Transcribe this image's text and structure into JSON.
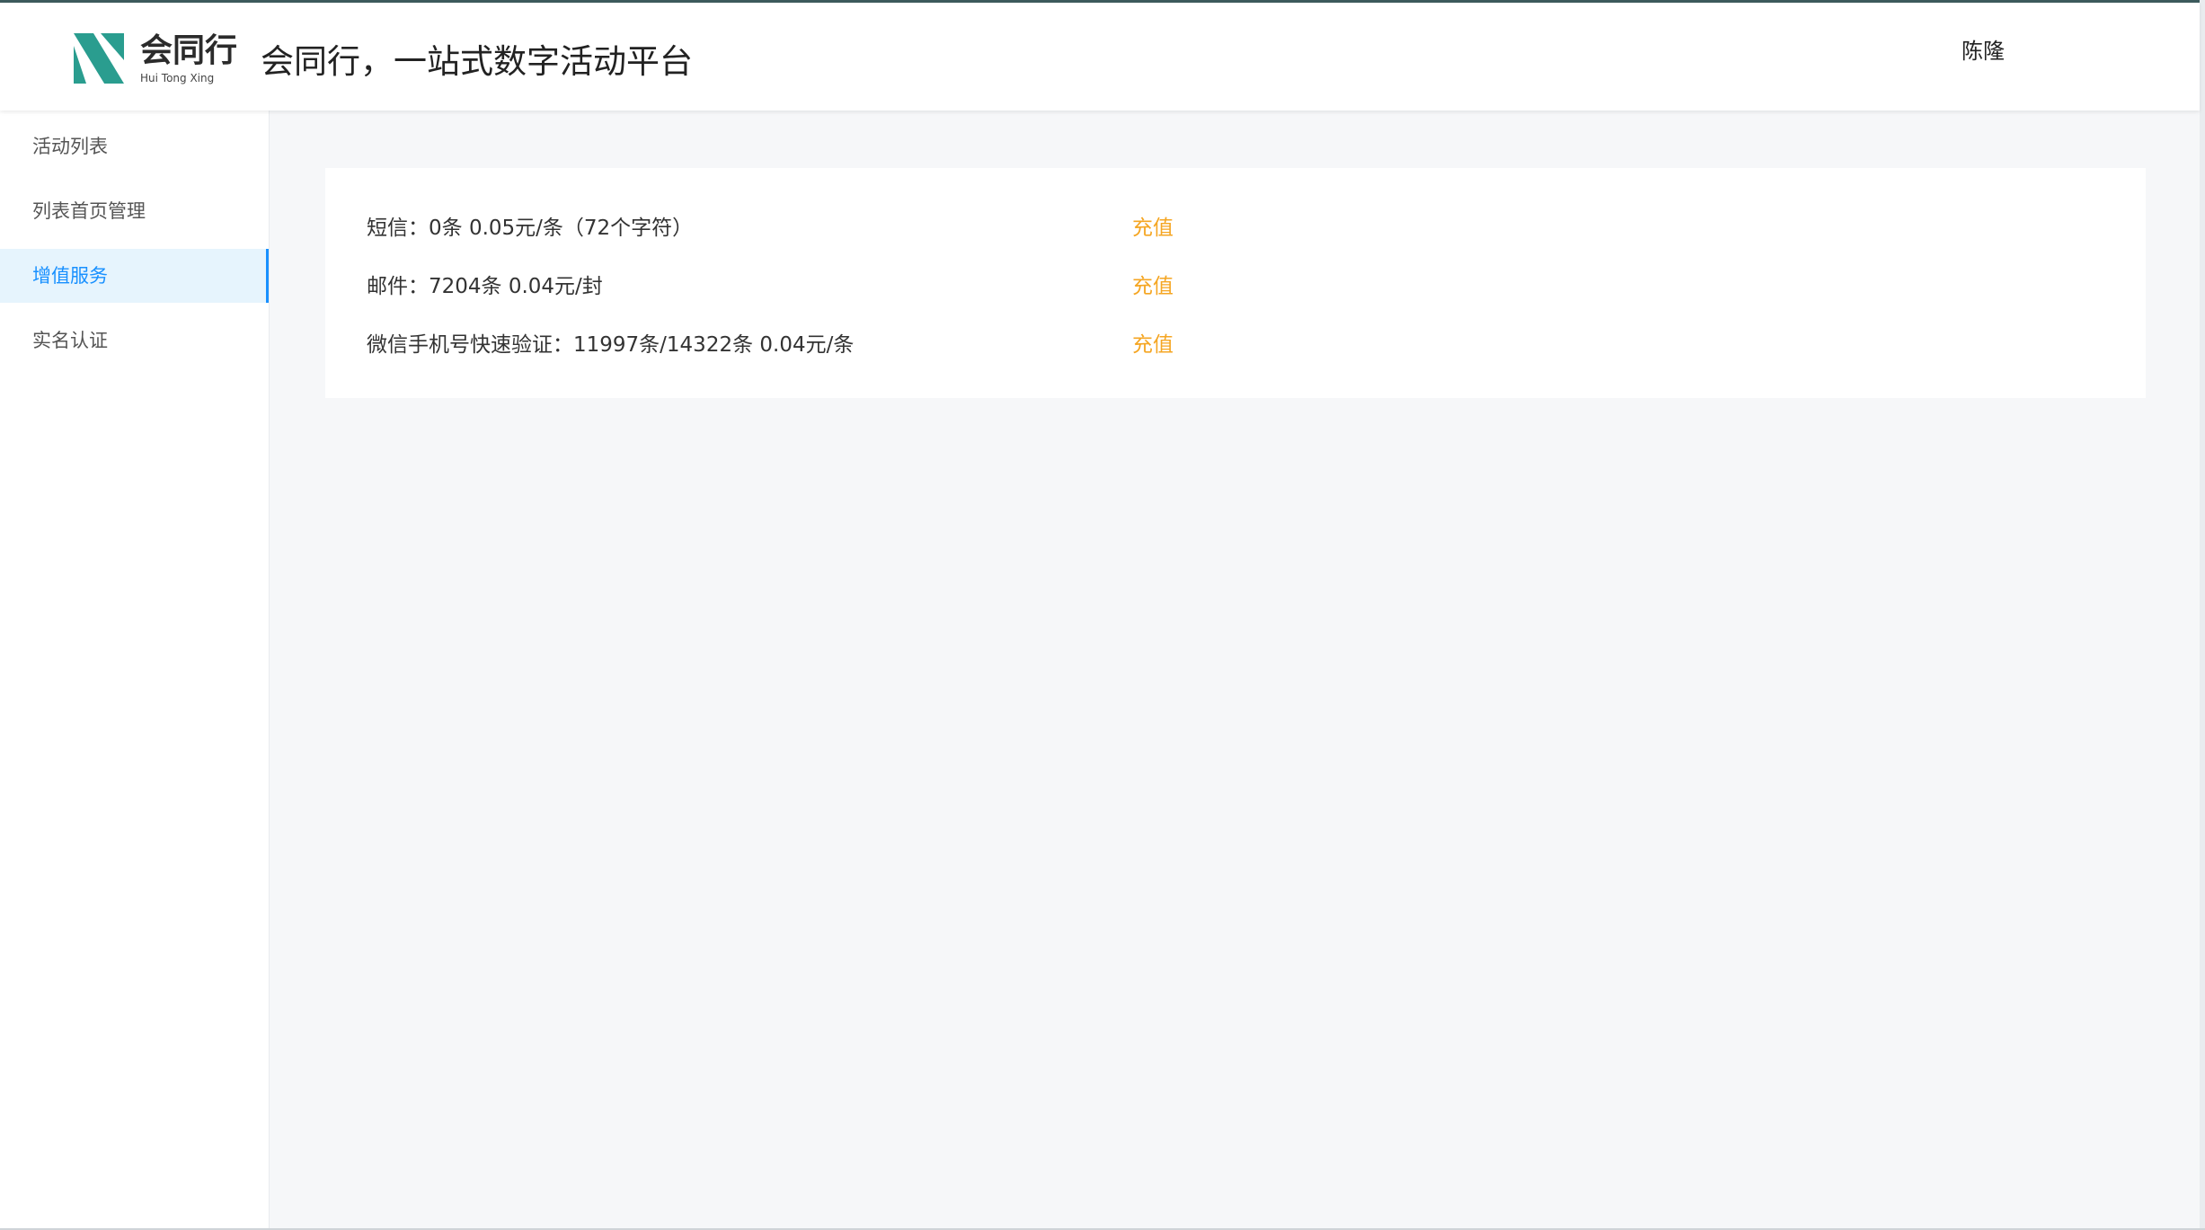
{
  "header": {
    "logo_name": "会同行",
    "logo_pinyin": "Hui Tong Xing",
    "site_title": "会同行，一站式数字活动平台",
    "user_name": "陈隆"
  },
  "sidebar": {
    "items": [
      {
        "label": "活动列表",
        "active": false
      },
      {
        "label": "列表首页管理",
        "active": false
      },
      {
        "label": "增值服务",
        "active": true
      },
      {
        "label": "实名认证",
        "active": false
      }
    ]
  },
  "services": [
    {
      "text": "短信：0条 0.05元/条（72个字符）",
      "action": "充值"
    },
    {
      "text": "邮件：7204条 0.04元/封",
      "action": "充值"
    },
    {
      "text": "微信手机号快速验证：11997条/14322条 0.04元/条",
      "action": "充值"
    }
  ],
  "colors": {
    "brand_teal": "#2a9d8f",
    "active_blue": "#1890ff",
    "recharge_orange": "#f5a623"
  }
}
